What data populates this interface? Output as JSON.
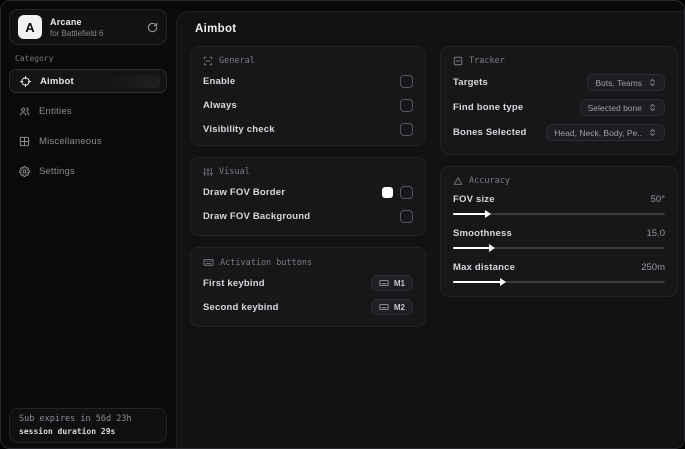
{
  "sidebar": {
    "brand": {
      "logo_letter": "A",
      "name": "Arcane",
      "subtitle": "for Battlefield 6"
    },
    "category_label": "Category",
    "items": [
      {
        "label": "Aimbot",
        "icon": "crosshair-icon",
        "selected": true
      },
      {
        "label": "Entities",
        "icon": "entities-icon",
        "selected": false
      },
      {
        "label": "Miscellaneous",
        "icon": "grid-icon",
        "selected": false
      },
      {
        "label": "Settings",
        "icon": "gear-icon",
        "selected": false
      }
    ],
    "footer": {
      "expiry": "Sub expires in 56d 23h",
      "session": "session duration 29s"
    }
  },
  "main": {
    "title": "Aimbot",
    "general": {
      "title": "General",
      "rows": [
        {
          "label": "Enable",
          "checked": false
        },
        {
          "label": "Always",
          "checked": false
        },
        {
          "label": "Visibility check",
          "checked": false
        }
      ]
    },
    "visual": {
      "title": "Visual",
      "rows": [
        {
          "label": "Draw FOV Border",
          "swatch": "#ffffff",
          "checked": false
        },
        {
          "label": "Draw FOV Background",
          "checked": false
        }
      ]
    },
    "activation": {
      "title": "Activation buttons",
      "rows": [
        {
          "label": "First keybind",
          "key": "M1"
        },
        {
          "label": "Second keybind",
          "key": "M2"
        }
      ]
    },
    "tracker": {
      "title": "Tracker",
      "rows": [
        {
          "label": "Targets",
          "value": "Bots, Teams"
        },
        {
          "label": "Find bone type",
          "value": "Selected bone"
        },
        {
          "label": "Bones Selected",
          "value": "Head, Neck, Body, Pe.."
        }
      ]
    },
    "accuracy": {
      "title": "Accuracy",
      "rows": [
        {
          "label": "FOV size",
          "value": "50°",
          "percent": 16
        },
        {
          "label": "Smoothness",
          "value": "15.0",
          "percent": 18
        },
        {
          "label": "Max distance",
          "value": "250m",
          "percent": 23
        }
      ]
    }
  },
  "colors": {
    "background": "#0a0a0b",
    "panel": "#121214",
    "card": "#17171a",
    "border": "#242428",
    "text_primary": "#e8e8ec",
    "text_muted": "#8b8b91",
    "slider_fill": "#ffffff",
    "swatch": "#ffffff"
  }
}
